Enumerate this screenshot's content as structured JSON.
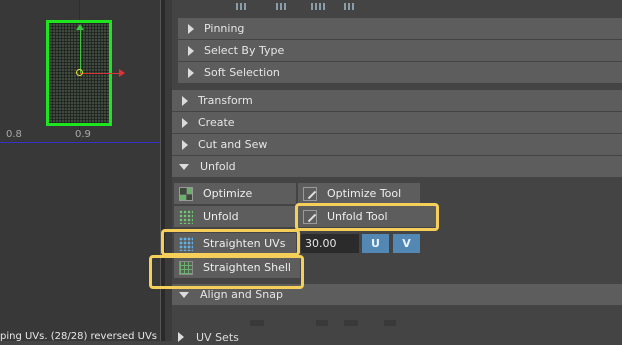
{
  "viewport": {
    "tick_left": "0.8",
    "tick_mid": "0.9",
    "status_text": "ping UVs. (28/28) reversed UVs"
  },
  "toolkit": {
    "top_icons": [
      "uv-shell-icon",
      "uv-grid-icon",
      "uv-tiles-icon",
      "uv-layout-icon"
    ],
    "sections": {
      "pinning": "Pinning",
      "select_by_type": "Select By Type",
      "soft_selection": "Soft Selection",
      "transform": "Transform",
      "create": "Create",
      "cut_and_sew": "Cut and Sew",
      "unfold": "Unfold",
      "align_and_snap": "Align and Snap",
      "uv_sets": "UV Sets"
    },
    "unfold_tools": {
      "optimize": "Optimize",
      "optimize_tool": "Optimize Tool",
      "unfold": "Unfold",
      "unfold_tool": "Unfold Tool",
      "straighten_uvs": "Straighten UVs",
      "straighten_value": "30.00",
      "u_button": "U",
      "v_button": "V",
      "straighten_shell": "Straighten Shell"
    },
    "highlight_color": "#f5cf5a",
    "accent_color": "#5388b4"
  }
}
